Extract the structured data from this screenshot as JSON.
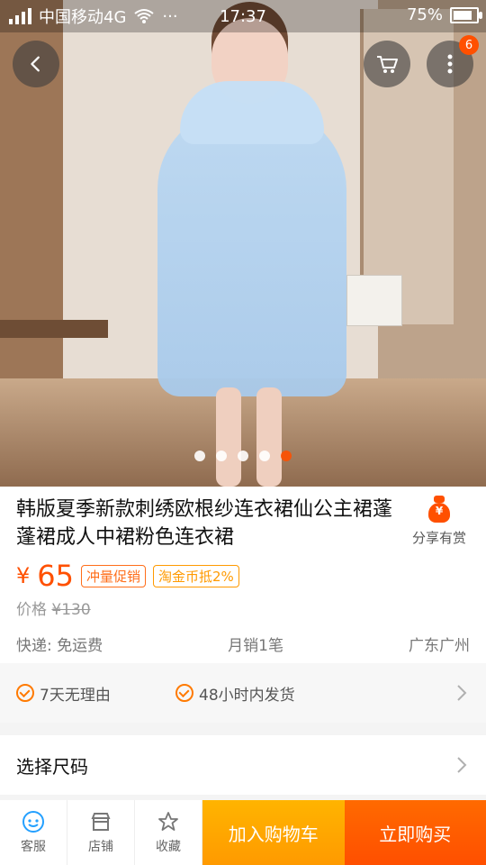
{
  "status": {
    "carrier": "中国移动4G",
    "time": "17:37",
    "battery": "75%",
    "more": "···"
  },
  "top_actions": {
    "badge_count": "6"
  },
  "carousel": {
    "count": 5,
    "active_index": 4
  },
  "product": {
    "title": "韩版夏季新款刺绣欧根纱连衣裙仙公主裙蓬蓬裙成人中裙粉色连衣裙",
    "share_label": "分享有赏",
    "currency": "¥",
    "price": "65",
    "tags": {
      "promo": "冲量促销",
      "coin": "淘金币抵2%"
    },
    "orig_label": "价格",
    "orig_price": "¥130",
    "shipping": "快递: 免运费",
    "monthly_sales": "月销1笔",
    "location": "广东广州"
  },
  "service": {
    "items": [
      "7天无理由",
      "48小时内发货"
    ]
  },
  "select_size": {
    "label": "选择尺码"
  },
  "toolbar": {
    "service": "客服",
    "shop": "店铺",
    "favorite": "收藏",
    "add_to_cart": "加入购物车",
    "buy_now": "立即购买"
  },
  "colors": {
    "accent": "#ff5000",
    "cart": "#ff9a00"
  }
}
